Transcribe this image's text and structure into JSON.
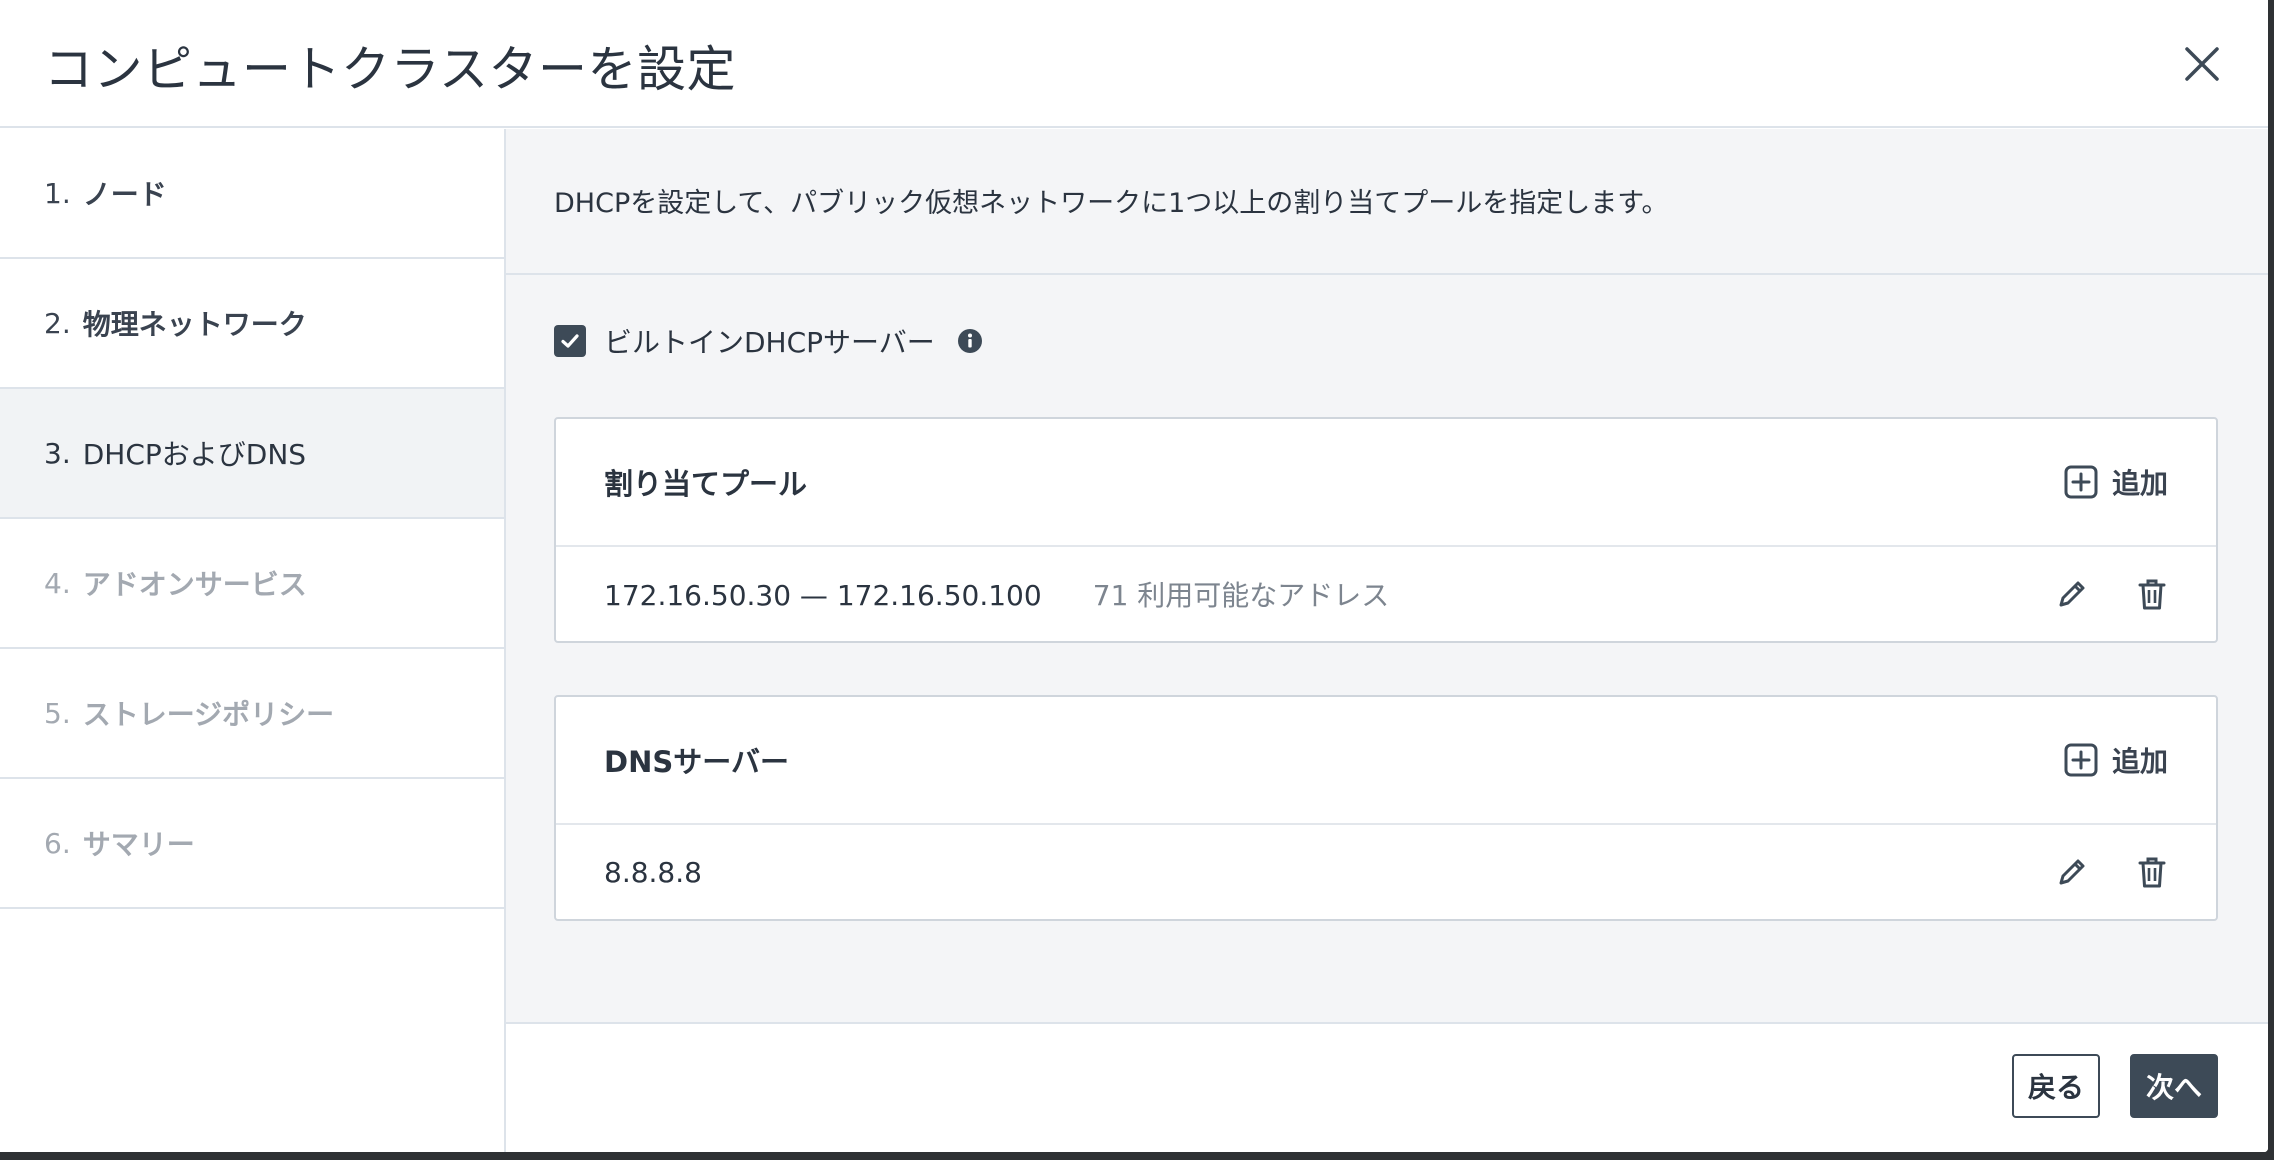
{
  "dialog": {
    "title": "コンピュートクラスターを設定"
  },
  "steps": [
    {
      "num": "1.",
      "label": "ノード",
      "state": "done"
    },
    {
      "num": "2.",
      "label": "物理ネットワーク",
      "state": "done"
    },
    {
      "num": "3.",
      "label": "DHCPおよびDNS",
      "state": "active"
    },
    {
      "num": "4.",
      "label": "アドオンサービス",
      "state": "disabled"
    },
    {
      "num": "5.",
      "label": "ストレージポリシー",
      "state": "disabled"
    },
    {
      "num": "6.",
      "label": "サマリー",
      "state": "disabled"
    }
  ],
  "content": {
    "intro": "DHCPを設定して、パブリック仮想ネットワークに1つ以上の割り当てプールを指定します。",
    "dhcp_checkbox_label": "ビルトインDHCPサーバー",
    "dhcp_checked": true,
    "pools": {
      "title": "割り当てプール",
      "add_label": "追加",
      "rows": [
        {
          "range": "172.16.50.30 — 172.16.50.100",
          "available": "71 利用可能なアドレス"
        }
      ]
    },
    "dns": {
      "title": "DNSサーバー",
      "add_label": "追加",
      "rows": [
        {
          "server": "8.8.8.8"
        }
      ]
    }
  },
  "footer": {
    "back_label": "戻る",
    "next_label": "次へ"
  },
  "colors": {
    "primary": "#3d4a57",
    "text": "#2b3440",
    "muted": "#a3a9b1",
    "border": "#dde3ea",
    "content_bg": "#f4f5f7"
  }
}
